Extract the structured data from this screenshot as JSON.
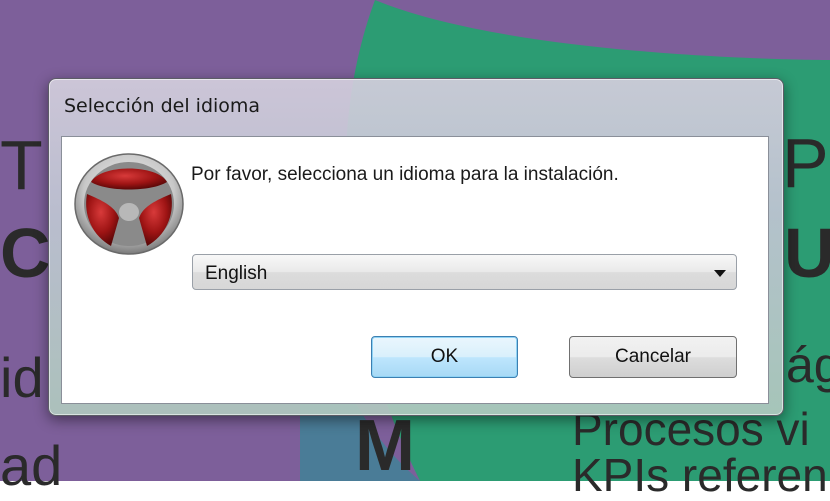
{
  "dialog": {
    "title": "Selección del idioma",
    "prompt": "Por favor, selecciona un idioma para la instalación.",
    "language_select": {
      "selected": "English"
    },
    "ok_label": "OK",
    "cancel_label": "Cancelar"
  },
  "background": {
    "fragments": [
      "T",
      "C",
      "id",
      "ad",
      "M",
      "PL",
      "U",
      "ág",
      "Procesos vi",
      "KPIs referen"
    ]
  },
  "colors": {
    "bg_purple": "#7d5f9a",
    "bg_green": "#2c9c73",
    "bg_teal": "#4a7c97",
    "logo_red": "#9e1414"
  },
  "icons": {
    "app_logo": "app-logo-icon",
    "dropdown": "chevron-down-icon"
  }
}
